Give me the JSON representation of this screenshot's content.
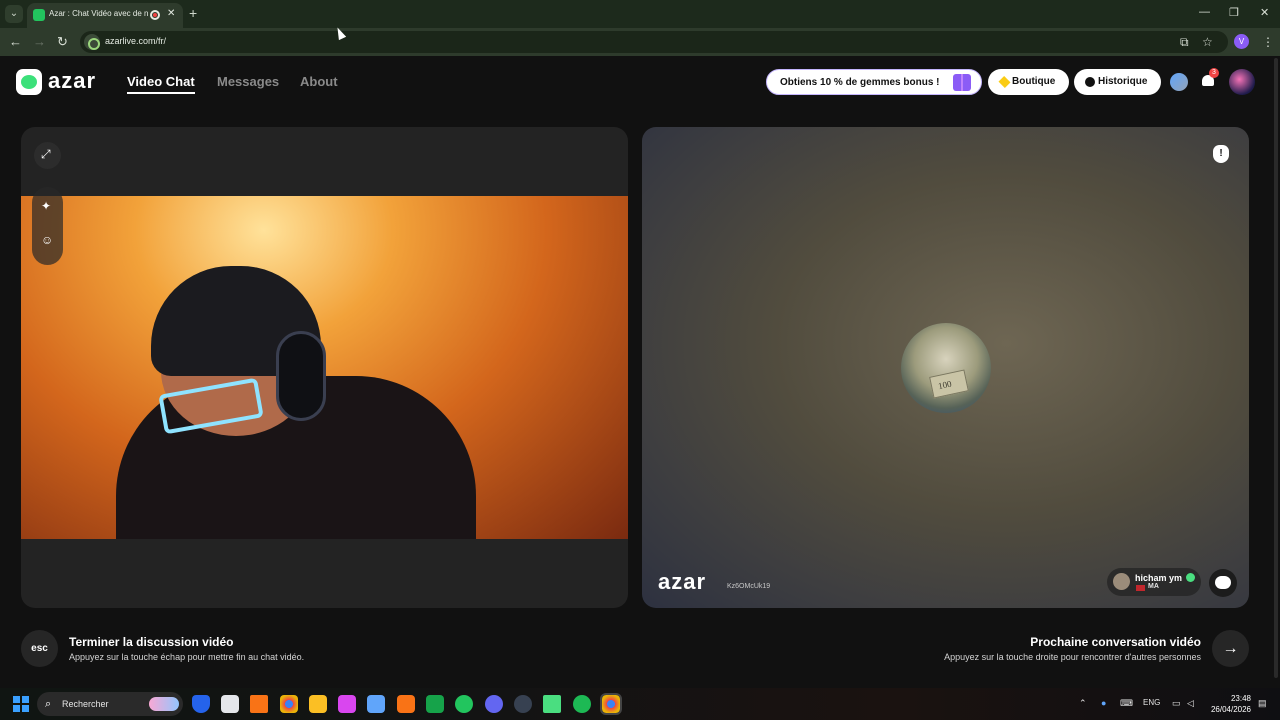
{
  "browser": {
    "tab_title": "Azar : Chat Vidéo avec de n",
    "tab_close": "✕",
    "new_tab": "+",
    "url": "azarlive.com/fr/",
    "profile_initial": "V",
    "window_controls": [
      "—",
      "❐",
      "✕"
    ]
  },
  "app": {
    "logo_text": "azar",
    "nav": [
      "Video Chat",
      "Messages",
      "About"
    ],
    "promo": "Obtiens 10 % de gemmes bonus !",
    "shop": "Boutique",
    "history": "Historique",
    "notifications_count": "3"
  },
  "partner": {
    "watermark": "azar",
    "session_id": "Kz6OMcUk19",
    "name": "hicham ym",
    "country": "MA"
  },
  "footer": {
    "esc_key": "esc",
    "end_title": "Terminer la discussion vidéo",
    "end_sub": "Appuyez sur la touche échap pour mettre fin au chat vidéo.",
    "next_title": "Prochaine conversation vidéo",
    "next_sub": "Appuyez sur la touche droite pour rencontrer d'autres personnes",
    "next_arrow": "→"
  },
  "taskbar": {
    "search": "Rechercher",
    "lang": "ENG",
    "time": "23:48",
    "date": "26/04/2026"
  },
  "colors": {
    "accent_green": "#3ce07a",
    "chrome_green": "#2e3b2c",
    "verified": "#4ade80",
    "badge": "#ef4444",
    "promo_border": "#c4b5fd"
  }
}
